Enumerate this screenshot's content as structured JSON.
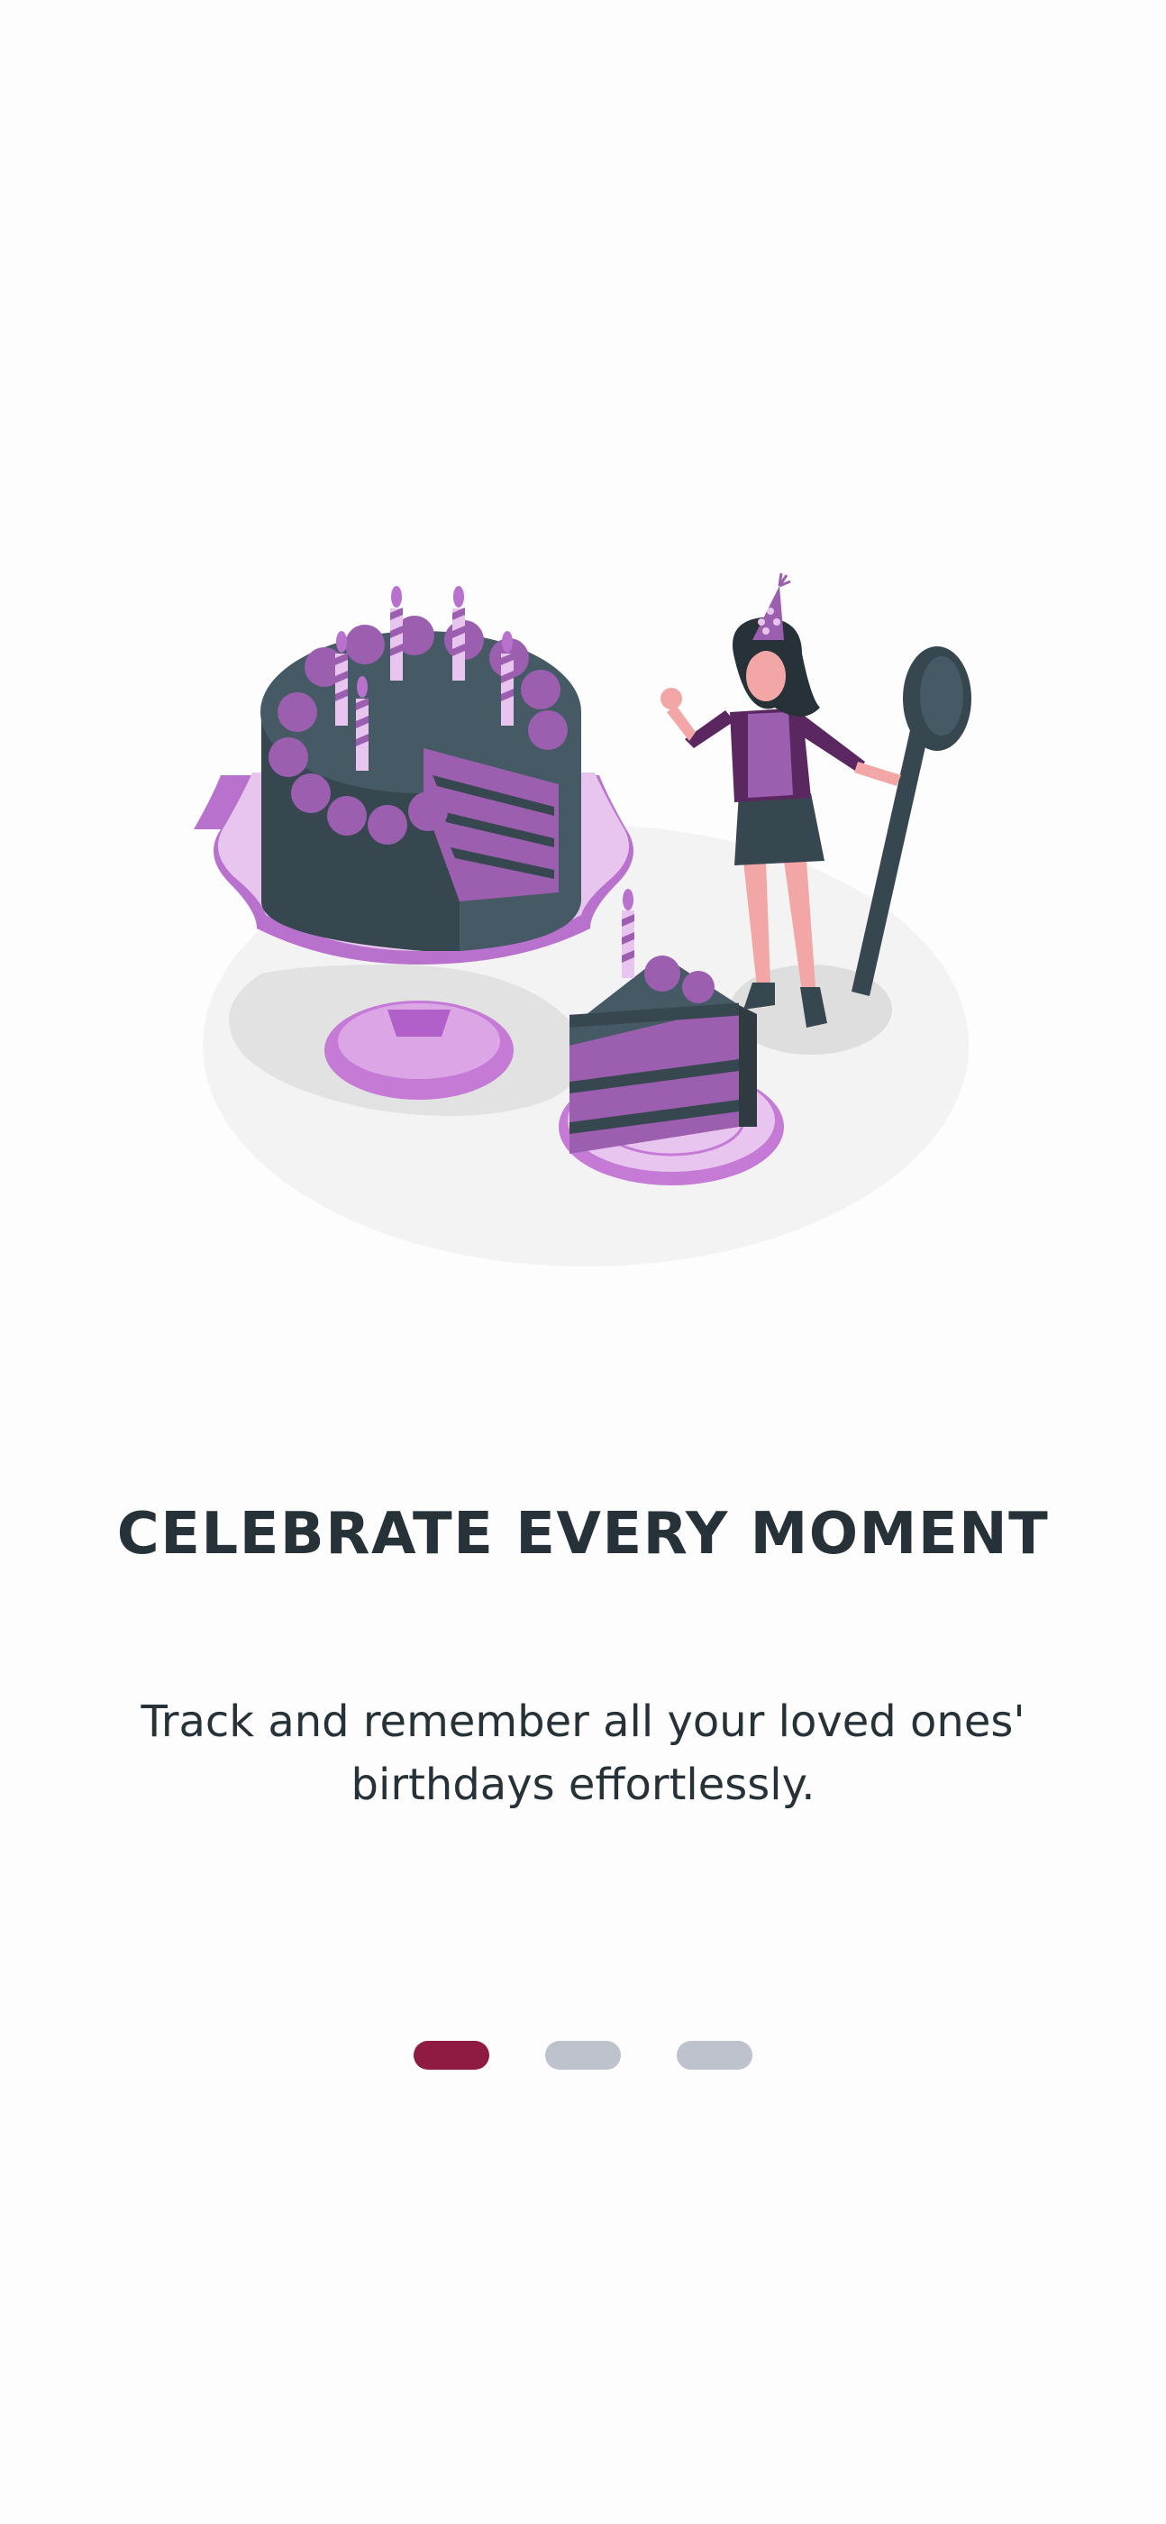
{
  "onboarding": {
    "title": "CELEBRATE EVERY MOMENT",
    "description": "Track and remember all your loved ones' birthdays effortlessly.",
    "illustration_icon": "birthday-cake-illustration",
    "page_indicator": {
      "total": 3,
      "active": 1
    }
  },
  "colors": {
    "title": "#263238",
    "accent": "#8f1a42",
    "inactive_dot": "#bec2cd",
    "cake_purple": "#9c5fb0",
    "cake_dark": "#37474f"
  }
}
